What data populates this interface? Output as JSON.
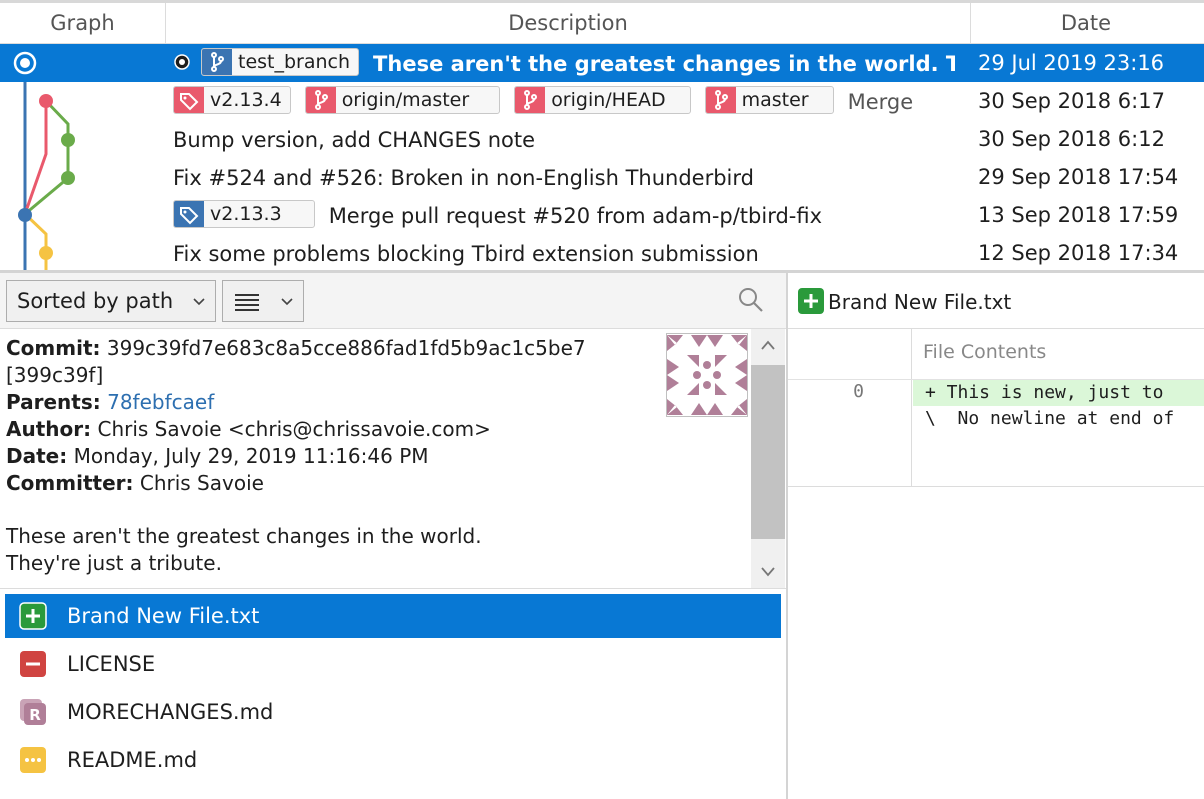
{
  "columns": {
    "graph": "Graph",
    "description": "Description",
    "date": "Date"
  },
  "commits": [
    {
      "refs": [
        {
          "kind": "branch",
          "label": "test_branch"
        }
      ],
      "message": "These aren't the greatest changes in the world. They're just a tribute.",
      "date": "29 Jul 2019 23:16",
      "selected": true
    },
    {
      "refs": [
        {
          "kind": "tag",
          "label": "v2.13.4"
        },
        {
          "kind": "branch",
          "label": "origin/master"
        },
        {
          "kind": "branch",
          "label": "origin/HEAD"
        },
        {
          "kind": "branch",
          "label": "master"
        }
      ],
      "message": "Merge",
      "date": "30 Sep 2018 6:17"
    },
    {
      "refs": [],
      "message": "Bump version, add CHANGES note",
      "date": "30 Sep 2018 6:12"
    },
    {
      "refs": [],
      "message": "Fix #524 and #526: Broken in non-English Thunderbird",
      "date": "29 Sep 2018 17:54"
    },
    {
      "refs": [
        {
          "kind": "tag",
          "label": "v2.13.3"
        }
      ],
      "message": "Merge pull request #520 from adam-p/tbird-fix",
      "date": "13 Sep 2018 17:59"
    },
    {
      "refs": [],
      "message": "Fix some problems blocking Tbird extension submission",
      "date": "12 Sep 2018 17:34"
    }
  ],
  "toolbar": {
    "sort_label": "Sorted by path"
  },
  "details": {
    "commit_label": "Commit:",
    "commit_hash": "399c39fd7e683c8a5cce886fad1fd5b9ac1c5be7",
    "short_hash": "[399c39f]",
    "parents_label": "Parents:",
    "parent_hash": "78febfcaef",
    "author_label": "Author:",
    "author": "Chris Savoie <chris@chrissavoie.com>",
    "date_label": "Date:",
    "date": "Monday, July 29, 2019 11:16:46 PM",
    "committer_label": "Committer:",
    "committer": "Chris Savoie",
    "message_line1": "These aren't the greatest changes in the world.",
    "message_line2": "They're just a tribute."
  },
  "files": [
    {
      "name": "Brand New File.txt",
      "status": "added",
      "selected": true
    },
    {
      "name": "LICENSE",
      "status": "deleted"
    },
    {
      "name": "MORECHANGES.md",
      "status": "renamed"
    },
    {
      "name": "README.md",
      "status": "modified"
    }
  ],
  "diff": {
    "file_title": "Brand New File.txt",
    "column_label": "File Contents",
    "line_number": "0",
    "added_line": "+ This is new, just to",
    "note_line": "\\  No newline at end of"
  },
  "colors": {
    "selection": "#0878d4",
    "branch_red": "#e9596c",
    "branch_blue": "#3b74b2",
    "graph_green": "#6aab4a",
    "graph_yellow": "#f5c342",
    "added_green": "#2a9a3b",
    "deleted_red": "#d04441",
    "renamed_mauve": "#b07f98",
    "modified_yellow": "#f5c342"
  }
}
